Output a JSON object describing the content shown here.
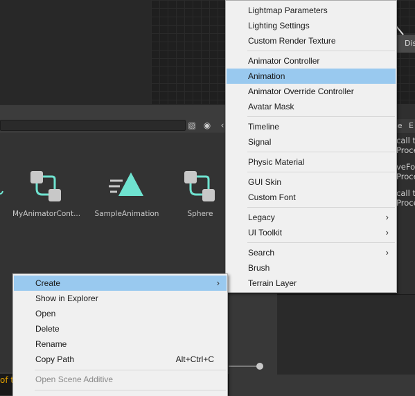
{
  "grid_node": {
    "label": "Dis"
  },
  "inspector": {
    "tab_partial": "se",
    "tab_partial_2": "E",
    "lines": [
      "call to",
      "Proce",
      "veFo",
      "Proce",
      "call to",
      "Proce"
    ]
  },
  "assets": [
    {
      "name": "MyAnimatorCont...",
      "icon": "animator-controller-icon"
    },
    {
      "name": "SampleAnimation",
      "icon": "animation-clip-icon"
    },
    {
      "name": "Sphere",
      "icon": "animator-controller-icon"
    }
  ],
  "status": {
    "text": "of t"
  },
  "create_submenu": {
    "items": [
      {
        "label": "Lightmap Parameters"
      },
      {
        "label": "Lighting Settings"
      },
      {
        "label": "Custom Render Texture"
      },
      {
        "label": "Animator Controller"
      },
      {
        "label": "Animation",
        "selected": true
      },
      {
        "label": "Animator Override Controller"
      },
      {
        "label": "Avatar Mask"
      },
      {
        "label": "Timeline"
      },
      {
        "label": "Signal"
      },
      {
        "label": "Physic Material"
      },
      {
        "label": "GUI Skin"
      },
      {
        "label": "Custom Font"
      },
      {
        "label": "Legacy",
        "submenu": true
      },
      {
        "label": "UI Toolkit",
        "submenu": true
      },
      {
        "label": "Search",
        "submenu": true
      },
      {
        "label": "Brush"
      },
      {
        "label": "Terrain Layer"
      }
    ]
  },
  "context_menu": {
    "items": [
      {
        "label": "Create",
        "selected": true,
        "submenu": true
      },
      {
        "label": "Show in Explorer"
      },
      {
        "label": "Open"
      },
      {
        "label": "Delete"
      },
      {
        "label": "Rename"
      },
      {
        "label": "Copy Path",
        "shortcut": "Alt+Ctrl+C"
      },
      {
        "label": "Open Scene Additive",
        "disabled": true
      }
    ]
  },
  "colors": {
    "highlight": "#99c9ef",
    "accent_teal": "#6fe3d0",
    "status_warning": "#e0a000"
  }
}
